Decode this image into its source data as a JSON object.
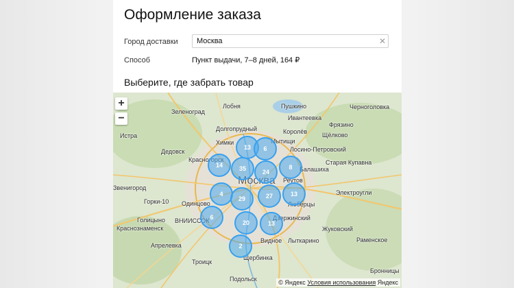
{
  "header": {
    "title": "Оформление заказа"
  },
  "delivery": {
    "city_label": "Город доставки",
    "city_value": "Москва",
    "method_label": "Способ",
    "method_value": "Пункт выдачи, 7–8 дней, 164 ₽"
  },
  "pickup": {
    "title": "Выберите, где забрать товар"
  },
  "map": {
    "zoom_in": "+",
    "zoom_out": "−",
    "places": [
      {
        "name": "Лобня"
      },
      {
        "name": "Пушкино"
      },
      {
        "name": "Черноголовка"
      },
      {
        "name": "Зеленоград"
      },
      {
        "name": "Ивантеевка"
      },
      {
        "name": "Фрязино"
      },
      {
        "name": "Долгопрудный"
      },
      {
        "name": "Королёв"
      },
      {
        "name": "Щёлково"
      },
      {
        "name": "Истра"
      },
      {
        "name": "Химки"
      },
      {
        "name": "Мытищи"
      },
      {
        "name": "Лосино-Петровский"
      },
      {
        "name": "Дедовск"
      },
      {
        "name": "Красногорск"
      },
      {
        "name": "Балашиха"
      },
      {
        "name": "Старая Купавна"
      },
      {
        "name": "Москва"
      },
      {
        "name": "Звенигород"
      },
      {
        "name": "Реутов"
      },
      {
        "name": "Электроугли"
      },
      {
        "name": "Горки-10"
      },
      {
        "name": "Одинцово"
      },
      {
        "name": "Люберцы"
      },
      {
        "name": "Голицыно"
      },
      {
        "name": "ВНИИССОК"
      },
      {
        "name": "Дзержинский"
      },
      {
        "name": "Краснознаменск"
      },
      {
        "name": "Жуковский"
      },
      {
        "name": "Апрелевка"
      },
      {
        "name": "Видное"
      },
      {
        "name": "Лыткарино"
      },
      {
        "name": "Раменское"
      },
      {
        "name": "Троицк"
      },
      {
        "name": "Щербинка"
      },
      {
        "name": "Подольск"
      },
      {
        "name": "Бронницы"
      }
    ],
    "clusters": [
      {
        "count": "13"
      },
      {
        "count": "6"
      },
      {
        "count": "14"
      },
      {
        "count": "35"
      },
      {
        "count": "24"
      },
      {
        "count": "8"
      },
      {
        "count": "4"
      },
      {
        "count": "29"
      },
      {
        "count": "27"
      },
      {
        "count": "13"
      },
      {
        "count": "6"
      },
      {
        "count": "20"
      },
      {
        "count": "13"
      },
      {
        "count": "2"
      }
    ],
    "copyright": {
      "owner": "© Яндекс",
      "terms": "Условия использования",
      "logo": "Яндекс"
    }
  }
}
